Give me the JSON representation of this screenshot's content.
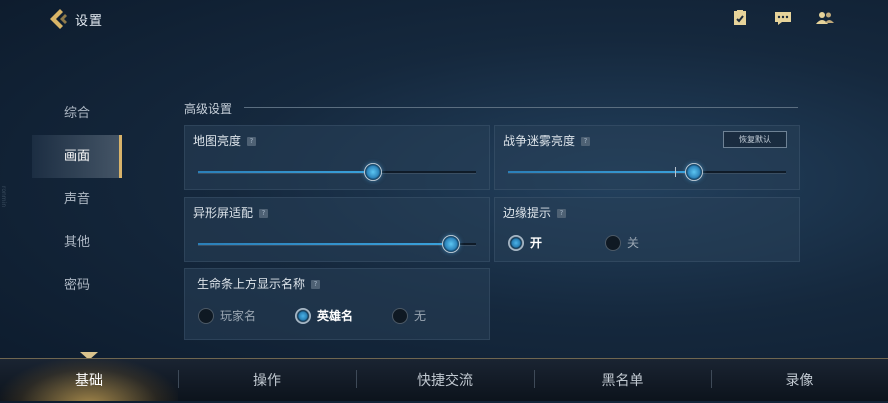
{
  "header": {
    "title": "设置",
    "icons": [
      "back-arrow-icon",
      "checklist-icon",
      "chat-icon",
      "friends-icon"
    ]
  },
  "sidebar": {
    "items": [
      {
        "label": "综合"
      },
      {
        "label": "画面",
        "active": true
      },
      {
        "label": "声音"
      },
      {
        "label": "其他"
      },
      {
        "label": "密码"
      }
    ]
  },
  "section": {
    "title": "高级设置"
  },
  "panels": {
    "map_brightness": {
      "label": "地图亮度",
      "help": "?",
      "value_fraction": 0.63
    },
    "fog_brightness": {
      "label": "战争迷雾亮度",
      "help": "?",
      "reset_label": "恢复默认",
      "value_fraction": 0.67,
      "default_fraction": 0.6
    },
    "notch_adapt": {
      "label": "异形屏适配",
      "help": "?",
      "value_fraction": 0.91
    },
    "edge_hint": {
      "label": "边缘提示",
      "help": "?",
      "options": [
        "开",
        "关"
      ],
      "selected": "开"
    },
    "hp_bar_name": {
      "label": "生命条上方显示名称",
      "help": "?",
      "options": [
        "玩家名",
        "英雄名",
        "无"
      ],
      "selected": "英雄名"
    }
  },
  "bottom_tabs": [
    {
      "label": "基础",
      "active": true
    },
    {
      "label": "操作"
    },
    {
      "label": "快捷交流"
    },
    {
      "label": "黑名单"
    },
    {
      "label": "录像"
    }
  ],
  "colors": {
    "accent": "#3aa2dc",
    "gold": "#d8b36a"
  }
}
